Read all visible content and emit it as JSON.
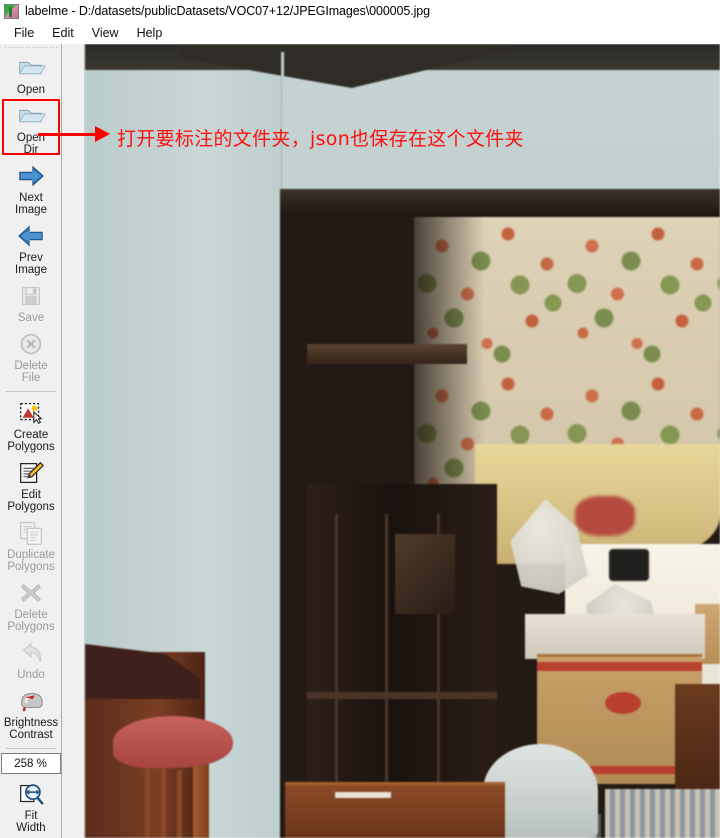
{
  "window": {
    "app_name": "labelme",
    "title": "labelme - D:/datasets/publicDatasets/VOC07+12/JPEGImages\\000005.jpg",
    "icon": "labelme-app-icon"
  },
  "menubar": {
    "items": [
      {
        "label": "File"
      },
      {
        "label": "Edit"
      },
      {
        "label": "View"
      },
      {
        "label": "Help"
      }
    ]
  },
  "toolbar": {
    "buttons": [
      {
        "label": "Open",
        "icon": "open-folder-icon",
        "enabled": true,
        "highlighted": false
      },
      {
        "label": "Open\nDir",
        "icon": "open-dir-folder-icon",
        "enabled": true,
        "highlighted": true
      },
      {
        "label": "Next\nImage",
        "icon": "arrow-right-icon",
        "enabled": true,
        "highlighted": false
      },
      {
        "label": "Prev\nImage",
        "icon": "arrow-left-icon",
        "enabled": true,
        "highlighted": false
      },
      {
        "label": "Save",
        "icon": "floppy-disk-icon",
        "enabled": false,
        "highlighted": false
      },
      {
        "label": "Delete\nFile",
        "icon": "circle-x-icon",
        "enabled": false,
        "highlighted": false
      },
      {
        "label": "Create\nPolygons",
        "icon": "create-polygon-icon",
        "enabled": true,
        "highlighted": false
      },
      {
        "label": "Edit\nPolygons",
        "icon": "edit-polygon-pencil-icon",
        "enabled": true,
        "highlighted": false
      },
      {
        "label": "Duplicate\nPolygons",
        "icon": "duplicate-pages-icon",
        "enabled": false,
        "highlighted": false
      },
      {
        "label": "Delete\nPolygons",
        "icon": "x-cross-icon",
        "enabled": false,
        "highlighted": false
      },
      {
        "label": "Undo",
        "icon": "undo-arrow-icon",
        "enabled": false,
        "highlighted": false
      },
      {
        "label": "Brightness\nContrast",
        "icon": "brightness-sphere-icon",
        "enabled": true,
        "highlighted": false
      }
    ],
    "zoom_value": "258 %",
    "fit_width": {
      "label": "Fit\nWidth",
      "icon": "fit-width-magnifier-icon",
      "enabled": true
    }
  },
  "annotation": {
    "text": "打开要标注的文件夹，json也保存在这个文件夹",
    "color": "#ff0000",
    "arrow": "red-arrow-pointing-right",
    "highlight_target": "Open Dir"
  },
  "canvas": {
    "image_name": "000005.jpg",
    "description": "room interior photo"
  },
  "colors": {
    "accent_red": "#ff0000",
    "window_bg": "#f0f0f0",
    "titlebar_bg": "#ffffff",
    "disabled_text": "#9a9a9a"
  }
}
